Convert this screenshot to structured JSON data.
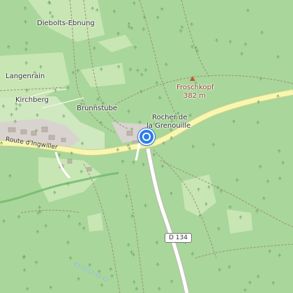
{
  "labels": {
    "diebolts_ebnung": "Diebolts-Ebnung",
    "langenrain": "Langenrain",
    "kirchberg": "Kirchberg",
    "brunnstube": "Brunnstube",
    "froschkopf_name": "Froschkopf",
    "froschkopf_elev": "382 m",
    "rocher_line1": "Rocher de",
    "rocher_line2": "la Grenouille",
    "route_ingwiller": "Route d'Ingwiller",
    "road_shield": "D 134"
  },
  "icons": {
    "location_marker": "location-pin-icon",
    "peak": "peak-triangle-icon",
    "tree": "tree-icon"
  },
  "colors": {
    "forest": "#a9d69a",
    "meadow": "#c9e6b0",
    "road_major": "#f7f7b0",
    "road_casing": "#d8cf8a",
    "river": "#aad3df",
    "marker": "#2b7de9",
    "peak": "#c25b2a"
  }
}
